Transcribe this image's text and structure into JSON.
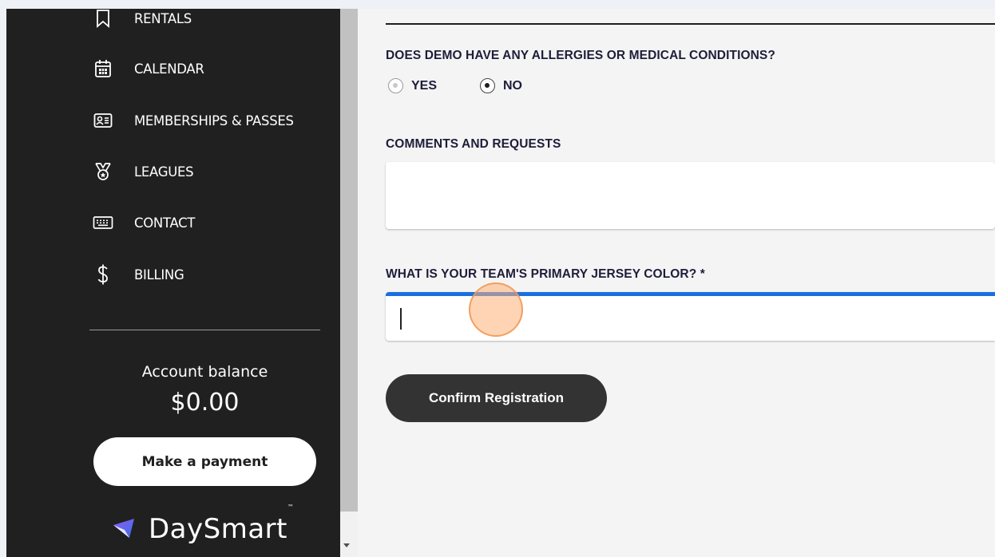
{
  "sidebar": {
    "items": [
      {
        "label": "RENTALS",
        "icon": "bookmark-icon"
      },
      {
        "label": "CALENDAR",
        "icon": "calendar-icon"
      },
      {
        "label": "MEMBERSHIPS & PASSES",
        "icon": "id-card-icon"
      },
      {
        "label": "LEAGUES",
        "icon": "medal-icon"
      },
      {
        "label": "CONTACT",
        "icon": "keyboard-icon"
      },
      {
        "label": "BILLING",
        "icon": "dollar-icon"
      }
    ],
    "balance_label": "Account balance",
    "balance_value": "$0.00",
    "payment_button": "Make a payment",
    "brand": "DaySmart",
    "brand_tm": "™"
  },
  "form": {
    "allergies_question": "DOES DEMO HAVE ANY ALLERGIES OR MEDICAL CONDITIONS?",
    "allergies_options": [
      {
        "label": "YES",
        "selected": false
      },
      {
        "label": "NO",
        "selected": true
      }
    ],
    "comments_label": "COMMENTS AND REQUESTS",
    "comments_value": "",
    "jersey_label": "WHAT IS YOUR TEAM'S PRIMARY JERSEY COLOR? *",
    "jersey_value": "",
    "confirm_button": "Confirm Registration"
  },
  "colors": {
    "sidebar_bg": "#202020",
    "focus_accent": "#1a6fe0",
    "button_dark": "#333333"
  }
}
